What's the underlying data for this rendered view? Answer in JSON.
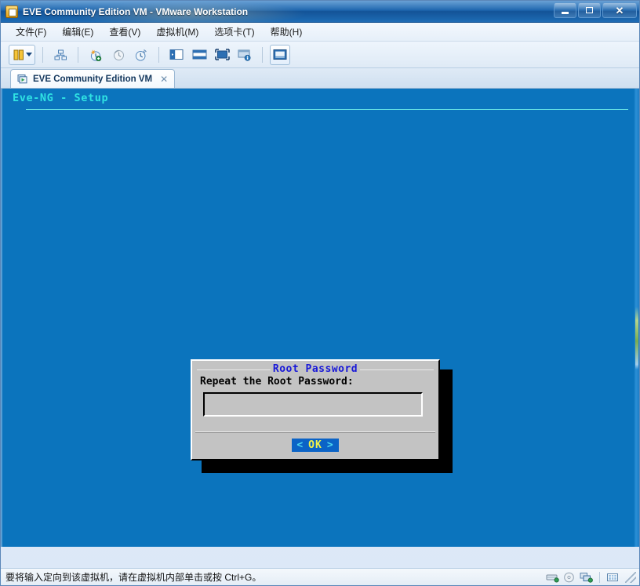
{
  "window": {
    "title": "EVE Community Edition VM - VMware Workstation",
    "app_icon": "vmware-workstation-icon",
    "controls": {
      "minimize": "minimize-button",
      "maximize": "maximize-button",
      "close": "close-button",
      "close_glyph": "✕"
    }
  },
  "menubar": {
    "items": [
      {
        "label": "文件(F)",
        "name": "menu-file"
      },
      {
        "label": "编辑(E)",
        "name": "menu-edit"
      },
      {
        "label": "查看(V)",
        "name": "menu-view"
      },
      {
        "label": "虚拟机(M)",
        "name": "menu-vm"
      },
      {
        "label": "选项卡(T)",
        "name": "menu-tabs"
      },
      {
        "label": "帮助(H)",
        "name": "menu-help"
      }
    ]
  },
  "toolbar": {
    "items": [
      {
        "name": "power-suspend-button",
        "icon": "pause-icon"
      },
      {
        "name": "power-dropdown-button",
        "icon": "chevron-down-icon"
      },
      {
        "name": "manage-snapshots-button",
        "icon": "snapshot-manager-icon"
      },
      {
        "name": "take-snapshot-button",
        "icon": "snapshot-add-icon"
      },
      {
        "name": "revert-snapshot-button",
        "icon": "snapshot-revert-icon"
      },
      {
        "name": "snapshot-manager-open-button",
        "icon": "snapshot-clock-icon"
      },
      {
        "name": "show-library-button",
        "icon": "library-panel-icon"
      },
      {
        "name": "show-thumbnail-bar-button",
        "icon": "thumbnail-bar-icon"
      },
      {
        "name": "full-screen-button",
        "icon": "fullscreen-icon"
      },
      {
        "name": "unity-mode-button",
        "icon": "unity-mode-icon"
      },
      {
        "name": "console-view-button",
        "icon": "console-view-icon"
      }
    ]
  },
  "tabs": [
    {
      "label": "EVE Community Edition VM",
      "name": "tab-eve-community-edition-vm",
      "icon": "vm-running-icon",
      "close_glyph": "✕"
    }
  ],
  "console": {
    "setup_title": "Eve-NG - Setup",
    "background_color": "#0b74bd",
    "title_color": "#2fe3e3"
  },
  "dialog": {
    "title": "Root Password",
    "title_color": "#1919d8",
    "prompt": "Repeat the Root Password:",
    "input_value": "",
    "background_color": "#c3c3c3",
    "button": {
      "left_bracket": "<",
      "label": "OK",
      "right_bracket": ">",
      "background_color": "#0b63c6",
      "label_color": "#f2f24a",
      "bracket_color": "#4fd8f0"
    }
  },
  "statusbar": {
    "message": "要将输入定向到该虚拟机，请在虚拟机内部单击或按 Ctrl+G。",
    "icons": [
      {
        "name": "hard-disk-icon"
      },
      {
        "name": "cd-dvd-icon"
      },
      {
        "name": "network-adapter-icon"
      },
      {
        "name": "usb-device-icon"
      }
    ]
  }
}
